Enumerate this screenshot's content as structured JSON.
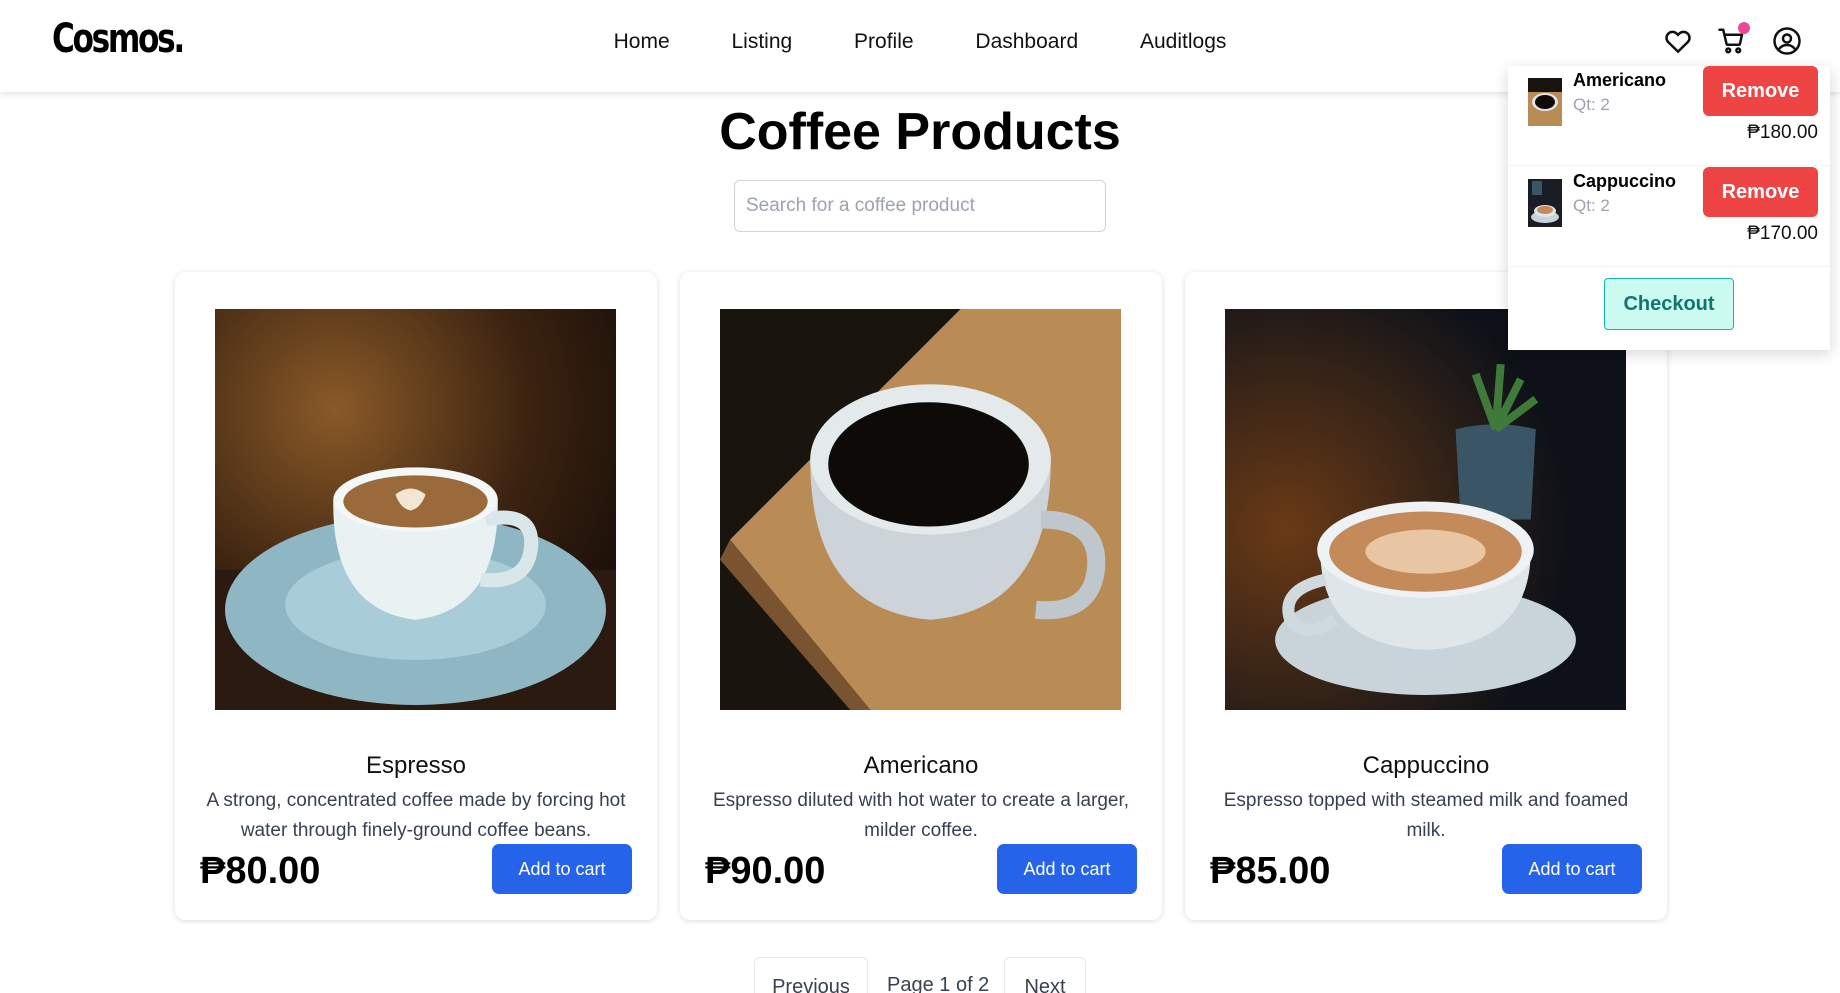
{
  "brand": {
    "logo": "Cosmos."
  },
  "nav": {
    "items": [
      "Home",
      "Listing",
      "Profile",
      "Dashboard",
      "Auditlogs"
    ]
  },
  "header_icons": [
    "heart-icon",
    "cart-icon",
    "user-circle-icon"
  ],
  "page": {
    "title": "Coffee Products",
    "search_placeholder": "Search for a coffee product"
  },
  "products": [
    {
      "name": "Espresso",
      "description": "A strong, concentrated coffee made by forcing hot water through finely-ground coffee beans.",
      "price": "₱80.00",
      "button": "Add to cart"
    },
    {
      "name": "Americano",
      "description": "Espresso diluted with hot water to create a larger, milder coffee.",
      "price": "₱90.00",
      "button": "Add to cart"
    },
    {
      "name": "Cappuccino",
      "description": "Espresso topped with steamed milk and foamed milk.",
      "price": "₱85.00",
      "button": "Add to cart"
    }
  ],
  "pagination": {
    "previous": "Previous",
    "indicator": "Page 1 of 2",
    "next": "Next"
  },
  "cart": {
    "items": [
      {
        "name": "Americano",
        "qty": "Qt: 2",
        "price": "₱180.00",
        "remove": "Remove"
      },
      {
        "name": "Cappuccino",
        "qty": "Qt: 2",
        "price": "₱170.00",
        "remove": "Remove"
      }
    ],
    "checkout": "Checkout"
  },
  "colors": {
    "primary": "#2563eb",
    "danger": "#ef4444",
    "checkout_bg": "#ccfbf1",
    "checkout_text": "#0f766e",
    "badge": "#ec4899"
  }
}
